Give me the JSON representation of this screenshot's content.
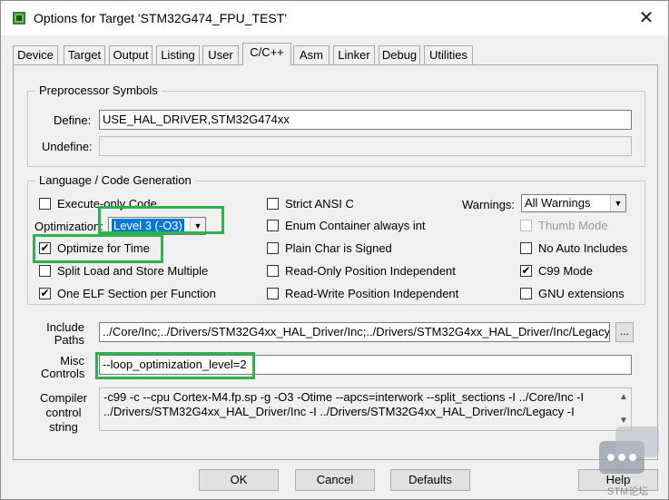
{
  "window": {
    "title": "Options for Target 'STM32G474_FPU_TEST'"
  },
  "tabs": [
    "Device",
    "Target",
    "Output",
    "Listing",
    "User",
    "C/C++",
    "Asm",
    "Linker",
    "Debug",
    "Utilities"
  ],
  "active_tab": "C/C++",
  "preprocessor": {
    "title": "Preprocessor Symbols",
    "define_label": "Define:",
    "define_value": "USE_HAL_DRIVER,STM32G474xx",
    "undefine_label": "Undefine:",
    "undefine_value": ""
  },
  "language": {
    "title": "Language / Code Generation",
    "execute_only": {
      "label": "Execute-only Code",
      "checked": false
    },
    "optimization_label": "Optimization:",
    "optimization_value": "Level 3 (-O3)",
    "optimize_time": {
      "label": "Optimize for Time",
      "checked": true
    },
    "split_load": {
      "label": "Split Load and Store Multiple",
      "checked": false
    },
    "one_elf": {
      "label": "One ELF Section per Function",
      "checked": true
    },
    "strict_ansi": {
      "label": "Strict ANSI C",
      "checked": false
    },
    "enum_container": {
      "label": "Enum Container always int",
      "checked": false
    },
    "plain_char": {
      "label": "Plain Char is Signed",
      "checked": false
    },
    "ro_pi": {
      "label": "Read-Only Position Independent",
      "checked": false
    },
    "rw_pi": {
      "label": "Read-Write Position Independent",
      "checked": false
    },
    "warnings_label": "Warnings:",
    "warnings_value": "All Warnings",
    "thumb_mode": {
      "label": "Thumb Mode",
      "checked": false,
      "disabled": true
    },
    "no_auto_includes": {
      "label": "No Auto Includes",
      "checked": false
    },
    "c99_mode": {
      "label": "C99 Mode",
      "checked": true
    },
    "gnu_extensions": {
      "label": "GNU extensions",
      "checked": false
    }
  },
  "include_paths": {
    "label_line1": "Include",
    "label_line2": "Paths",
    "value": "../Core/Inc;../Drivers/STM32G4xx_HAL_Driver/Inc;../Drivers/STM32G4xx_HAL_Driver/Inc/Legacy",
    "browse": "..."
  },
  "misc_controls": {
    "label_line1": "Misc",
    "label_line2": "Controls",
    "value": "--loop_optimization_level=2"
  },
  "compiler_control": {
    "label_line1": "Compiler",
    "label_line2": "control",
    "label_line3": "string",
    "line1": "-c99 -c --cpu Cortex-M4.fp.sp -g -O3 -Otime --apcs=interwork --split_sections -I ../Core/Inc -I",
    "line2": "../Drivers/STM32G4xx_HAL_Driver/Inc -I ../Drivers/STM32G4xx_HAL_Driver/Inc/Legacy -I"
  },
  "buttons": {
    "ok": "OK",
    "cancel": "Cancel",
    "defaults": "Defaults",
    "help": "Help"
  },
  "watermark": "STM论坛",
  "colors": {
    "highlight": "#2fb24e"
  }
}
